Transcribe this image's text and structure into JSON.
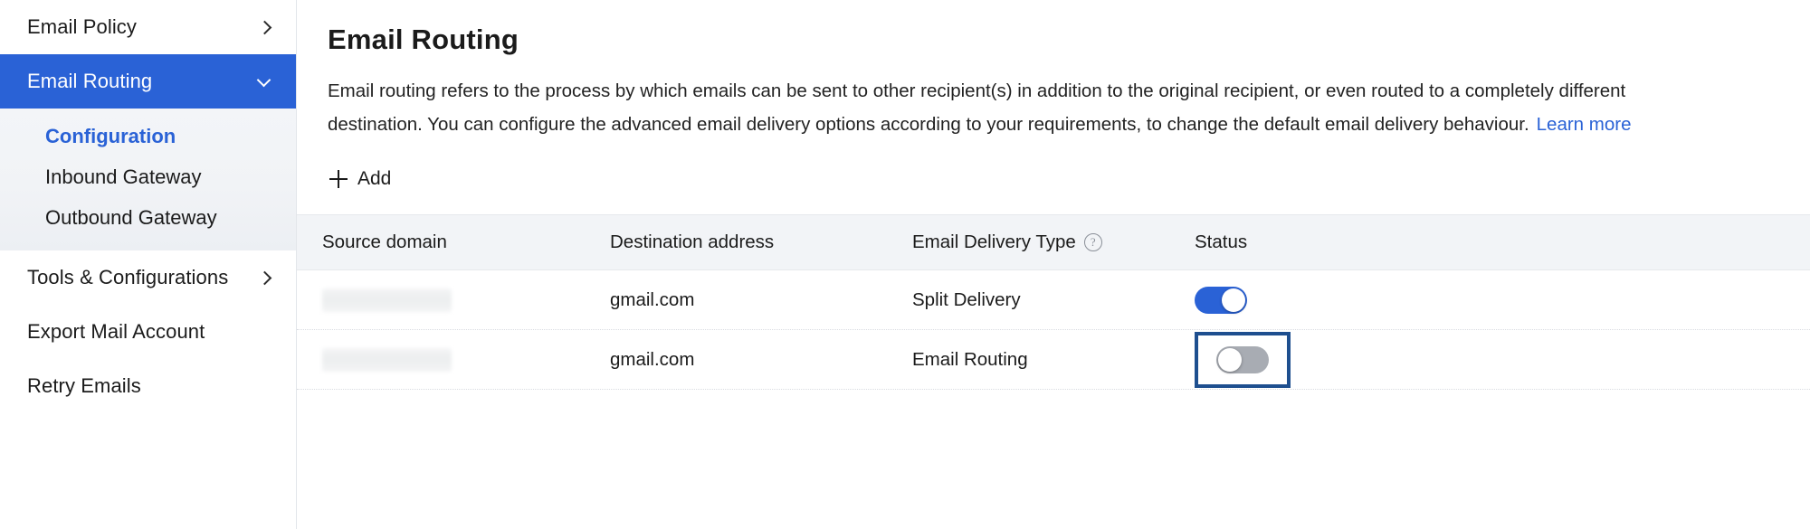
{
  "sidebar": {
    "items": [
      {
        "label": "Email Policy",
        "icon": "chevron-right-icon",
        "state": "collapsed",
        "type": "group"
      },
      {
        "label": "Email Routing",
        "icon": "chevron-down-icon",
        "state": "expanded",
        "type": "group",
        "active": true
      },
      {
        "label": "Tools & Configurations",
        "icon": "chevron-right-icon",
        "state": "collapsed",
        "type": "group"
      },
      {
        "label": "Export Mail Account",
        "icon": "",
        "state": "",
        "type": "link"
      },
      {
        "label": "Retry Emails",
        "icon": "",
        "state": "",
        "type": "link"
      }
    ],
    "subitems": [
      {
        "label": "Configuration",
        "selected": true
      },
      {
        "label": "Inbound Gateway",
        "selected": false
      },
      {
        "label": "Outbound Gateway",
        "selected": false
      }
    ]
  },
  "main": {
    "title": "Email Routing",
    "description": "Email routing refers to the process by which emails can be sent to other recipient(s) in addition to the original recipient, or even routed to a completely different destination. You can configure the advanced email delivery options according to your requirements, to change the default email delivery behaviour.",
    "learn_more": "Learn more",
    "add_label": "Add",
    "add_icon": "plus-icon"
  },
  "table": {
    "columns": [
      {
        "label": "Source domain",
        "help": false
      },
      {
        "label": "Destination address",
        "help": false
      },
      {
        "label": "Email Delivery Type",
        "help": true,
        "help_icon": "question-mark-circle-icon"
      },
      {
        "label": "Status",
        "help": false
      }
    ],
    "rows": [
      {
        "source_domain": "",
        "source_domain_redacted": true,
        "destination_address": "gmail.com",
        "delivery_type": "Split Delivery",
        "status_on": true,
        "status_highlighted": false
      },
      {
        "source_domain": "",
        "source_domain_redacted": true,
        "destination_address": "gmail.com",
        "delivery_type": "Email Routing",
        "status_on": false,
        "status_highlighted": true
      }
    ]
  },
  "colors": {
    "accent": "#2a62d6",
    "toggle_on": "#2a62d6",
    "toggle_off": "#a8acb3",
    "highlight_box": "#1e4f8f",
    "header_bg": "#f2f4f7",
    "subnav_bg": "#f1f3f6"
  }
}
